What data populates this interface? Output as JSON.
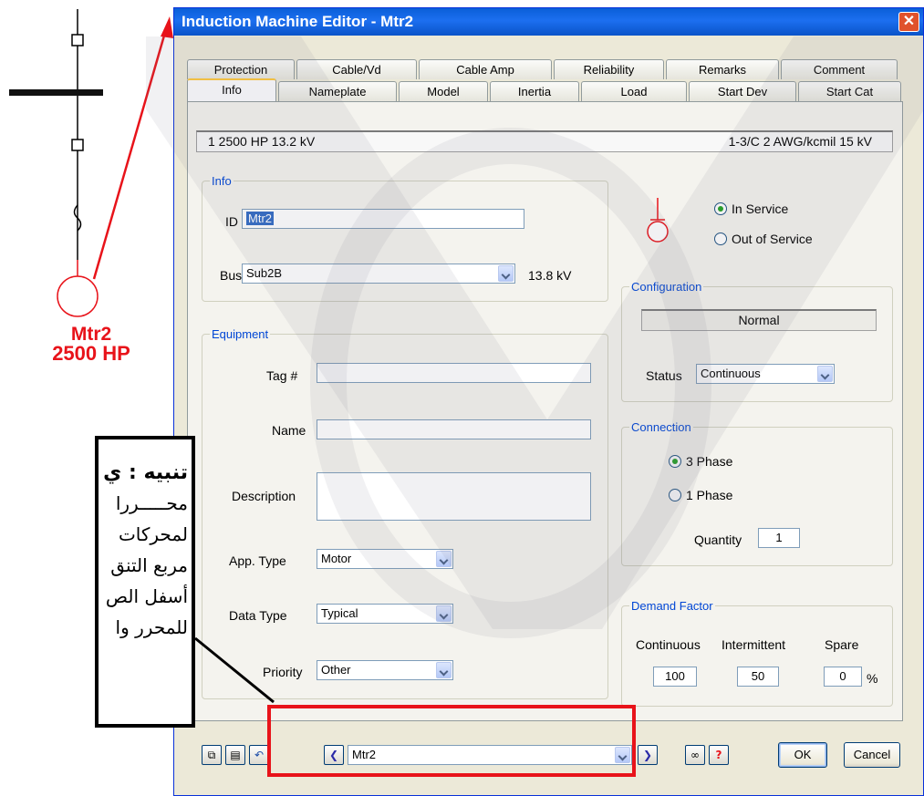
{
  "diagram": {
    "motor_name": "Mtr2",
    "motor_rating": "2500 HP"
  },
  "callout": {
    "title": "تنبيه : ي",
    "lines": [
      "محـــــررا",
      "لمحركات",
      "مربع التنق",
      "أسفل الص",
      "للمحرر وا"
    ]
  },
  "window": {
    "title": "Induction Machine Editor - Mtr2",
    "close_glyph": "✕"
  },
  "tabs": {
    "row1": [
      "Protection",
      "Cable/Vd",
      "Cable Amp",
      "Reliability",
      "Remarks",
      "Comment"
    ],
    "row2": [
      "Info",
      "Nameplate",
      "Model",
      "Inertia",
      "Load",
      "Start Dev",
      "Start Cat"
    ],
    "active": "Info"
  },
  "summary": {
    "left": "1  2500 HP  13.2 kV",
    "right": "1-3/C  2 AWG/kcmil  15 kV"
  },
  "info_group": {
    "legend": "Info",
    "id_label": "ID",
    "id_value": "Mtr2",
    "bus_label": "Bus",
    "bus_value": "Sub2B",
    "bus_kv": "13.8 kV"
  },
  "service": {
    "in_service": "In Service",
    "out_of_service": "Out of Service",
    "selected": "In Service"
  },
  "configuration": {
    "legend": "Configuration",
    "value": "Normal",
    "status_label": "Status",
    "status_value": "Continuous"
  },
  "equipment": {
    "legend": "Equipment",
    "tag_label": "Tag #",
    "tag_value": "",
    "name_label": "Name",
    "name_value": "",
    "description_label": "Description",
    "description_value": "",
    "app_type_label": "App. Type",
    "app_type_value": "Motor",
    "data_type_label": "Data Type",
    "data_type_value": "Typical",
    "priority_label": "Priority",
    "priority_value": "Other"
  },
  "connection": {
    "legend": "Connection",
    "three_phase": "3 Phase",
    "one_phase": "1 Phase",
    "selected": "3 Phase",
    "quantity_label": "Quantity",
    "quantity_value": "1"
  },
  "demand_factor": {
    "legend": "Demand Factor",
    "continuous_label": "Continuous",
    "intermittent_label": "Intermittent",
    "spare_label": "Spare",
    "continuous_value": "100",
    "intermittent_value": "50",
    "spare_value": "0",
    "unit": "%"
  },
  "bottom_bar": {
    "element_select": "Mtr2",
    "ok": "OK",
    "cancel": "Cancel",
    "help_glyph": "?"
  },
  "colors": {
    "accent_red": "#e8131a",
    "legend_blue": "#0046d5",
    "titlebar_blue": "#0a5fd8"
  }
}
